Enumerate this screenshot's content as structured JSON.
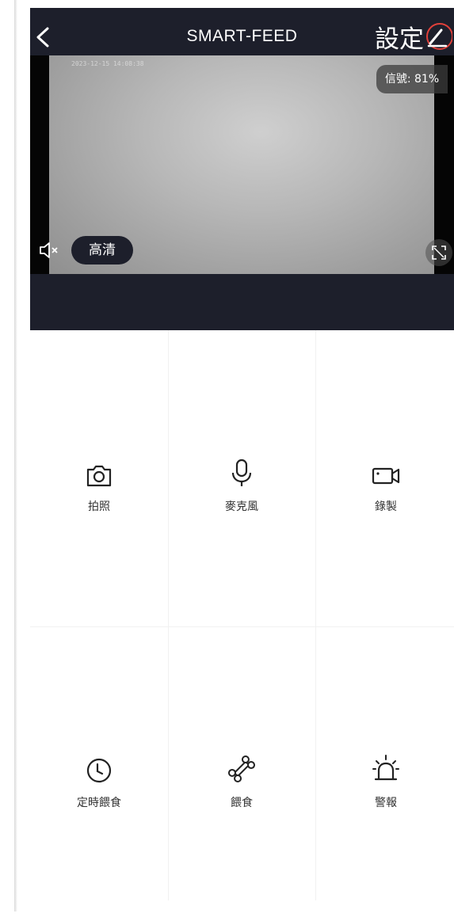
{
  "header": {
    "title": "SMART-FEED",
    "settings_label": "設定"
  },
  "video": {
    "timestamp": "2023-12-15 14:08:38",
    "signal_text": "信號: 81%",
    "quality_label": "高清"
  },
  "controls": [
    {
      "label": "拍照",
      "icon": "camera-icon"
    },
    {
      "label": "麥克風",
      "icon": "microphone-icon"
    },
    {
      "label": "錄製",
      "icon": "video-record-icon"
    },
    {
      "label": "定時餵食",
      "icon": "clock-icon"
    },
    {
      "label": "餵食",
      "icon": "bone-icon"
    },
    {
      "label": "警報",
      "icon": "alarm-icon"
    }
  ],
  "colors": {
    "header_bg": "#1d1f2b",
    "accent_red": "#e0403a"
  }
}
